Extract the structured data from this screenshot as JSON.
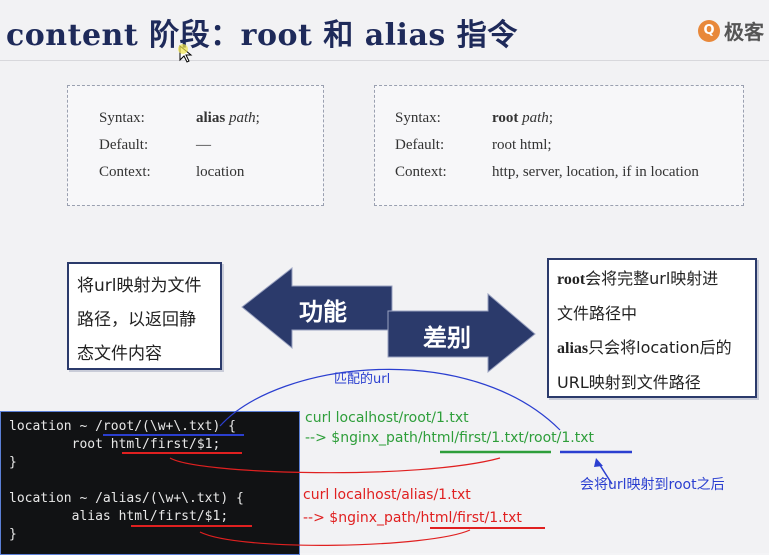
{
  "slide": {
    "title": "content 阶段：root 和 alias 指令",
    "brand": "极客",
    "alias_box": {
      "syntax_label": "Syntax:",
      "syntax_name": "alias",
      "syntax_arg": "path",
      "syntax_end": ";",
      "default_label": "Default:",
      "default_value": "—",
      "context_label": "Context:",
      "context_value": "location"
    },
    "root_box": {
      "syntax_label": "Syntax:",
      "syntax_name": "root",
      "syntax_arg": "path",
      "syntax_end": ";",
      "default_label": "Default:",
      "default_value": "root html;",
      "context_label": "Context:",
      "context_value": "http, server, location, if in location"
    },
    "function_card": {
      "line1": "将url映射为文件",
      "line2": "路径，以返回静",
      "line3": "态文件内容"
    },
    "arrow_left_label": "功能",
    "arrow_right_label": "差别",
    "diff_card": {
      "root_keyword": "root",
      "line1_rest": "会将完整url映射进",
      "line2": "文件路径中",
      "alias_keyword": "alias",
      "line3_rest": "只会将location后的",
      "line4": "URL映射到文件路径"
    }
  },
  "terminal": {
    "lines": [
      "location ~ /root/(\\w+\\.txt) {",
      "        root html/first/$1;",
      "}",
      "",
      "location ~ /alias/(\\w+\\.txt) {",
      "        alias html/first/$1;",
      "}"
    ]
  },
  "annotations": {
    "match_url": "匹配的url",
    "curl_root": "curl localhost/root/1.txt",
    "result_root": " --> $nginx_path/html/first/1.txt/root/1.txt",
    "root_note": "会将url映射到root之后",
    "curl_alias": "curl localhost/alias/1.txt",
    "result_alias": "--> $nginx_path/html/first/1.txt"
  },
  "colors": {
    "title": "#1e2a5a",
    "card_border": "#2b3a6b",
    "arrow_fill": "#2b3a6b",
    "terminal_bg": "#111214",
    "green_annotation": "#2e9e3a",
    "red_annotation": "#e02020",
    "blue_annotation": "#2b3fd0"
  }
}
